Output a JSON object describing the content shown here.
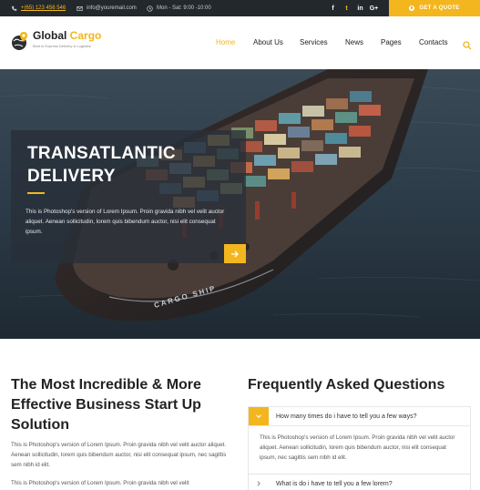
{
  "topbar": {
    "phone": "+(65) 123 456 546",
    "email": "info@youremail.com",
    "hours": "Mon - Sat: 9:00 -10:00",
    "social": [
      {
        "icon": "facebook-icon",
        "label": "f"
      },
      {
        "icon": "twitter-icon",
        "label": "t"
      },
      {
        "icon": "linkedin-icon",
        "label": "in"
      },
      {
        "icon": "google-plus-icon",
        "label": "G+"
      }
    ],
    "quote_label": "GET A QUOTE"
  },
  "header": {
    "brand_first": "Global",
    "brand_second": " Cargo",
    "tagline": "Best in Express Delivery & Logistics",
    "nav": [
      "Home",
      "About Us",
      "Services",
      "News",
      "Pages",
      "Contacts"
    ],
    "active_nav": "Home"
  },
  "hero": {
    "title_line1": "TRANSATLANTIC",
    "title_line2": "DELIVERY",
    "body": "This is Photoshop's version  of Lorem Ipsum. Proin gravida nibh vel velit auctor aliquet. Aenean sollicitudin, lorem quis bibendum auctor, nisi elit consequat ipsum.",
    "ship_text": "CARGO SHIP"
  },
  "intro": {
    "title": "The Most Incredible & More Effective Business Start Up Solution",
    "p1": "This is Photoshop's version  of Lorem Ipsum. Proin gravida nibh vel velit auctor aliquet. Aenean sollicitudin, lorem quis bibendum auctor, nisi elit consequat ipsum, nec sagittis sem nibh id elit.",
    "p2": "This is Photoshop's version  of Lorem Ipsum. Proin gravida nibh vel velit"
  },
  "faq": {
    "title": "Frequently Asked Questions",
    "items": [
      {
        "question": "How many times do i have to tell you a few ways?",
        "open": true
      },
      {
        "question": "What is do i have to tell you a few lorem?",
        "open": false
      }
    ],
    "answer": "This is Photoshop's version  of Lorem Ipsum. Proin gravida nibh vel velit auctor aliquet. Aenean sollicitudin, lorem quis bibendum auctor, nisi elit consequat ipsum, nec sagittis sem nibh id elit."
  },
  "colors": {
    "accent": "#f3b61f",
    "topbar_bg": "#23282d",
    "text_dark": "#222222"
  }
}
